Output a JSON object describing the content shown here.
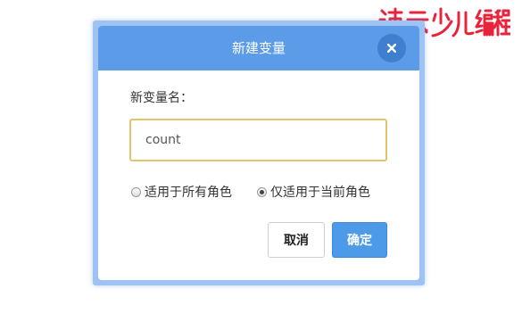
{
  "watermark": {
    "text": "速云少儿编程"
  },
  "dialog": {
    "title": "新建变量",
    "close_icon": "close-icon",
    "field_label": "新变量名：",
    "input_value": "count",
    "scope_options": [
      {
        "label": "适用于所有角色",
        "selected": false
      },
      {
        "label": "仅适用于当前角色",
        "selected": true
      }
    ],
    "cancel_label": "取消",
    "ok_label": "确定"
  },
  "colors": {
    "header": "#5b9be8",
    "close_button": "#3f7fd0",
    "input_border": "#e3c36b",
    "ok_button": "#4d9be8",
    "watermark": "#e8243c"
  }
}
